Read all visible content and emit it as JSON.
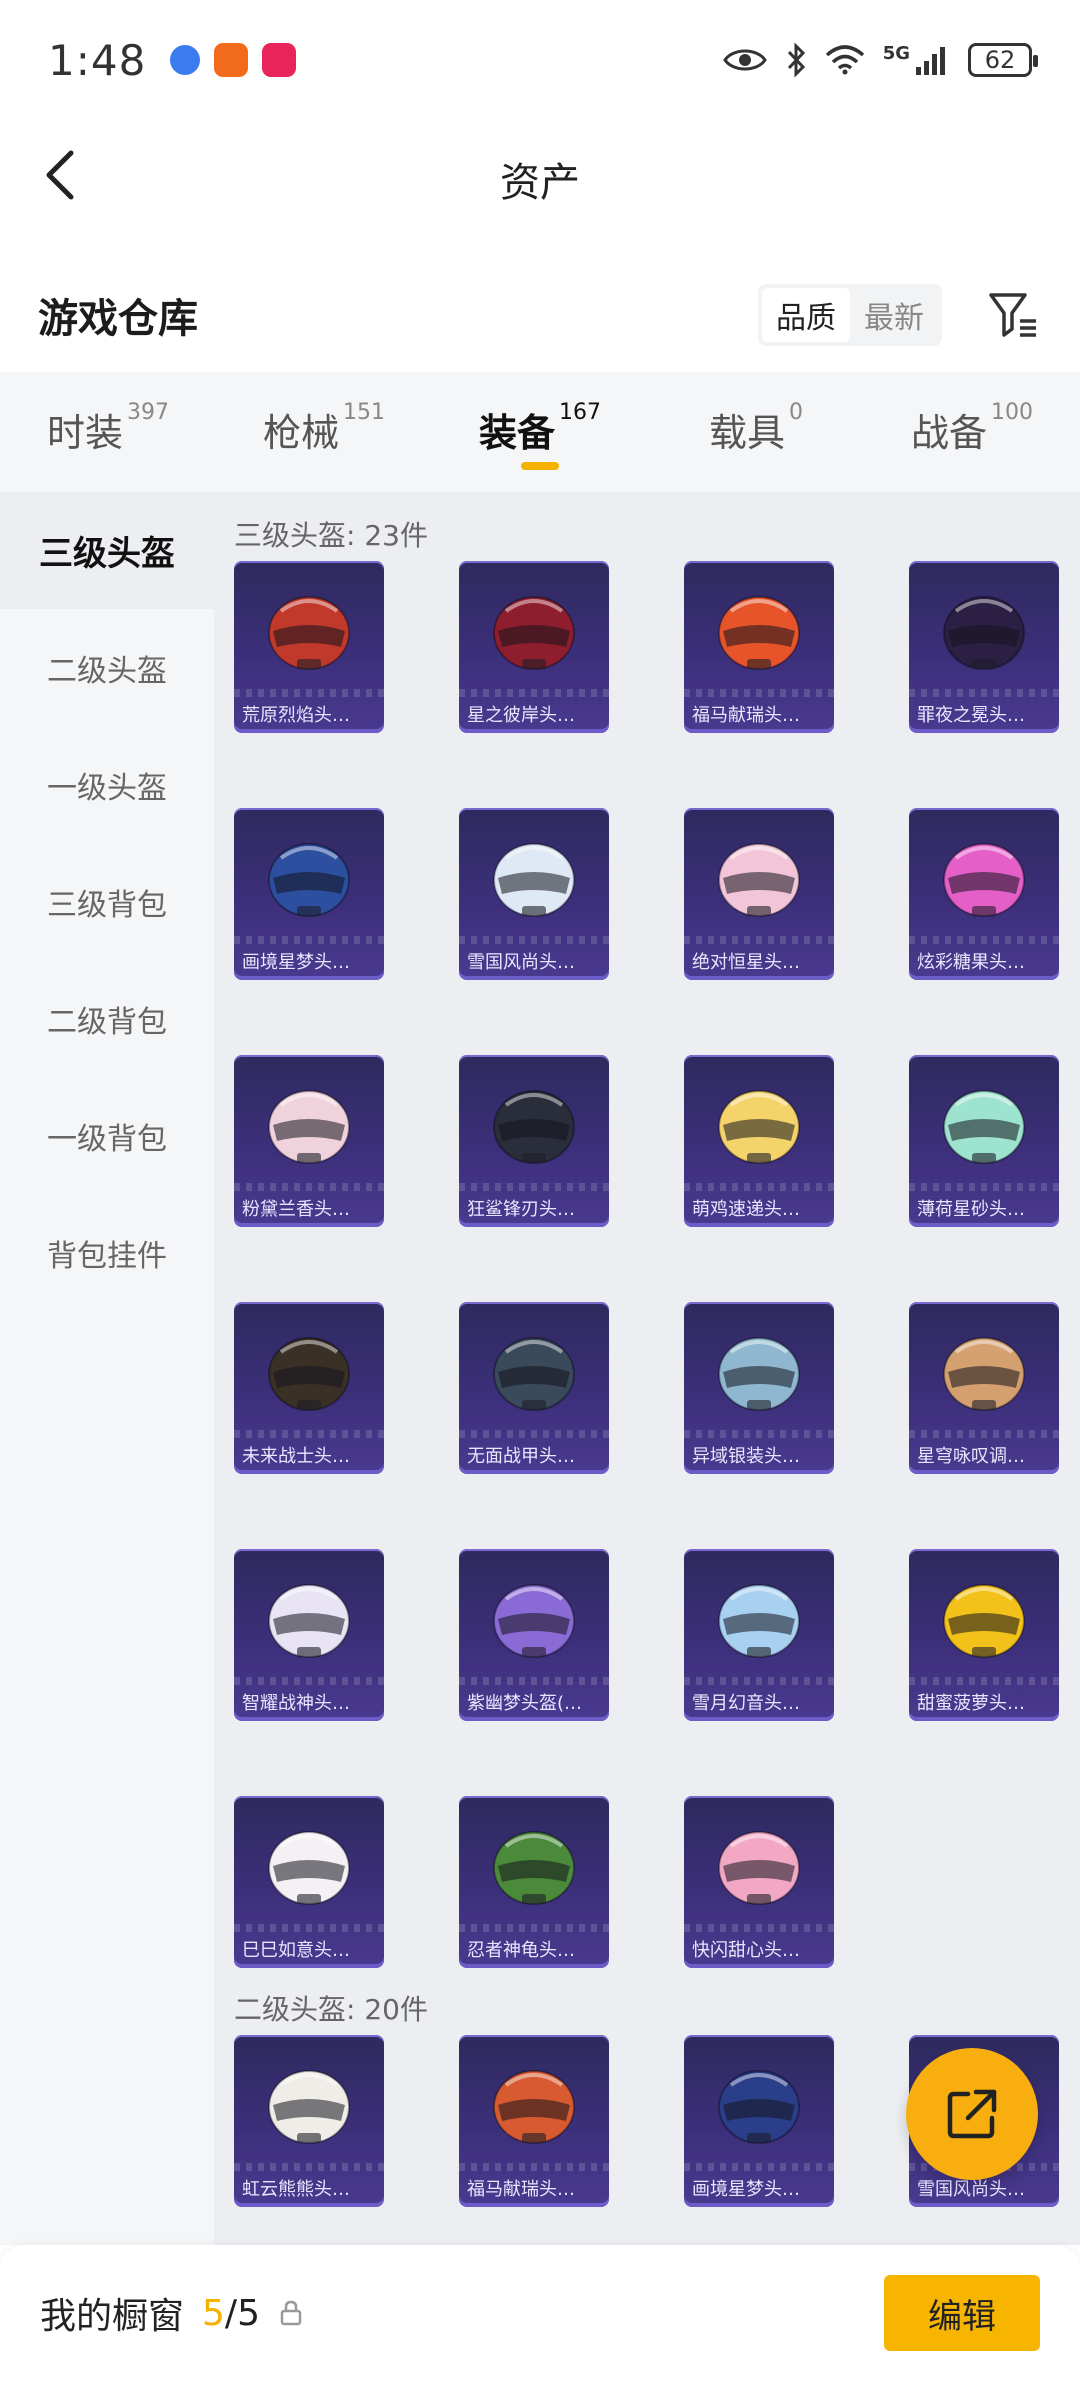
{
  "status_bar": {
    "time": "1:48",
    "network": "5G",
    "battery": "62"
  },
  "nav": {
    "title": "资产"
  },
  "warehouse": {
    "title": "游戏仓库",
    "sort_options": [
      {
        "label": "品质",
        "active": true
      },
      {
        "label": "最新",
        "active": false
      }
    ]
  },
  "category_tabs": [
    {
      "label": "时装",
      "count": "397",
      "active": false
    },
    {
      "label": "枪械",
      "count": "151",
      "active": false
    },
    {
      "label": "装备",
      "count": "167",
      "active": true
    },
    {
      "label": "载具",
      "count": "0",
      "active": false
    },
    {
      "label": "战备",
      "count": "100",
      "active": false
    }
  ],
  "sidebar": {
    "items": [
      {
        "label": "三级头盔",
        "active": true
      },
      {
        "label": "二级头盔",
        "active": false
      },
      {
        "label": "一级头盔",
        "active": false
      },
      {
        "label": "三级背包",
        "active": false
      },
      {
        "label": "二级背包",
        "active": false
      },
      {
        "label": "一级背包",
        "active": false
      },
      {
        "label": "背包挂件",
        "active": false
      }
    ]
  },
  "sections": [
    {
      "title": "三级头盔: 23件",
      "items": [
        {
          "name": "荒原烈焰头…",
          "color": "#c0392b"
        },
        {
          "name": "星之彼岸头…",
          "color": "#8e1e2e"
        },
        {
          "name": "福马献瑞头…",
          "color": "#e8542a"
        },
        {
          "name": "罪夜之冕头…",
          "color": "#2b1f44"
        },
        {
          "name": "画境星梦头…",
          "color": "#2d4fa0"
        },
        {
          "name": "雪国风尚头…",
          "color": "#dfe8f5"
        },
        {
          "name": "绝对恒星头…",
          "color": "#f2c6d8"
        },
        {
          "name": "炫彩糖果头…",
          "color": "#e45fc8"
        },
        {
          "name": "粉黛兰香头…",
          "color": "#f0d2dc"
        },
        {
          "name": "狂鲨锋刃头…",
          "color": "#2a2e3a"
        },
        {
          "name": "萌鸡速递头…",
          "color": "#f5d36b"
        },
        {
          "name": "薄荷星砂头…",
          "color": "#9ee3cf"
        },
        {
          "name": "未来战士头…",
          "color": "#3a3026"
        },
        {
          "name": "无面战甲头…",
          "color": "#3a4a5a"
        },
        {
          "name": "异域银装头…",
          "color": "#8fb8d0"
        },
        {
          "name": "星穹咏叹调…",
          "color": "#d4a070"
        },
        {
          "name": "智耀战神头…",
          "color": "#e8e4f4"
        },
        {
          "name": "紫幽梦头盔(…",
          "color": "#8a6ad4"
        },
        {
          "name": "雪月幻音头…",
          "color": "#a8d0f0"
        },
        {
          "name": "甜蜜菠萝头…",
          "color": "#f2c21a"
        },
        {
          "name": "巳巳如意头…",
          "color": "#f4f0f4"
        },
        {
          "name": "忍者神龟头…",
          "color": "#4a8a3a"
        },
        {
          "name": "快闪甜心头…",
          "color": "#f2a8c4"
        }
      ]
    },
    {
      "title": "二级头盔: 20件",
      "items": [
        {
          "name": "虹云熊熊头…",
          "color": "#f0ede8"
        },
        {
          "name": "福马献瑞头…",
          "color": "#d85a30"
        },
        {
          "name": "画境星梦头…",
          "color": "#2a3e8a"
        },
        {
          "name": "雪国风尚头…",
          "color": "#dfe8f5"
        }
      ]
    }
  ],
  "bottom_bar": {
    "label": "我的橱窗",
    "current": "5",
    "separator": "/",
    "max": "5",
    "edit_label": "编辑"
  }
}
